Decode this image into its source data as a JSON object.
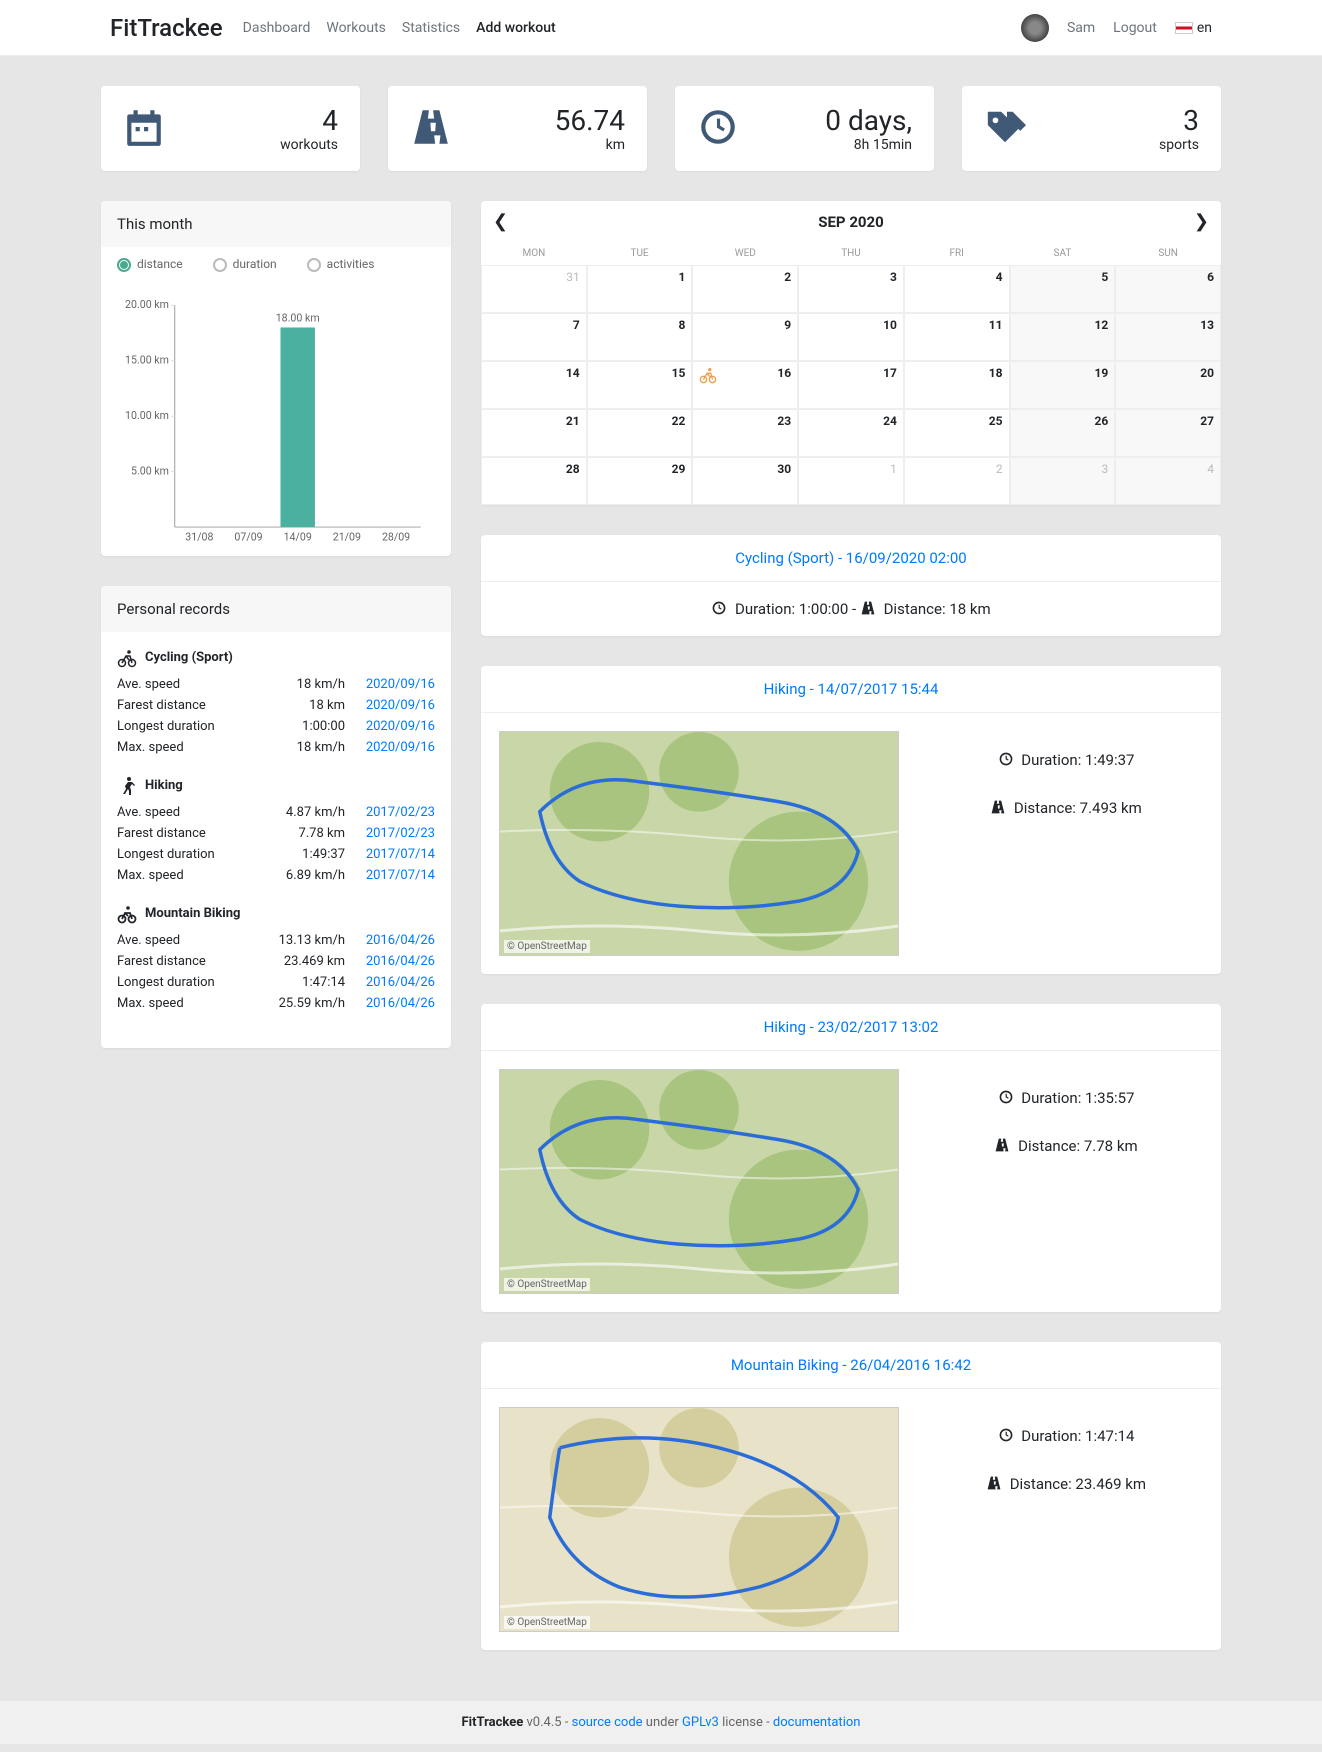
{
  "nav": {
    "brand": "FitTrackee",
    "links": [
      "Dashboard",
      "Workouts",
      "Statistics",
      "Add workout"
    ],
    "user": "Sam",
    "logout": "Logout",
    "lang": "en"
  },
  "stats": {
    "workouts": {
      "value": "4",
      "label": "workouts"
    },
    "distance": {
      "value": "56.74",
      "label": "km"
    },
    "duration": {
      "value": "0 days,",
      "label": "8h 15min"
    },
    "sports": {
      "value": "3",
      "label": "sports"
    }
  },
  "monthPanel": {
    "title": "This month",
    "radios": [
      "distance",
      "duration",
      "activities"
    ],
    "chart_data": {
      "type": "bar",
      "categories": [
        "31/08",
        "07/09",
        "14/09",
        "21/09",
        "28/09"
      ],
      "values": [
        0,
        0,
        18.0,
        0,
        0
      ],
      "value_labels": [
        "",
        "",
        "18.00 km",
        "",
        ""
      ],
      "ylabel": "km",
      "yticks": [
        5.0,
        10.0,
        15.0,
        20.0
      ],
      "ylim": [
        0,
        20
      ]
    }
  },
  "records": {
    "title": "Personal records",
    "labels": {
      "ave": "Ave. speed",
      "far": "Farest distance",
      "dur": "Longest duration",
      "max": "Max. speed"
    },
    "sports": [
      {
        "name": "Cycling (Sport)",
        "icon": "cycling",
        "rows": [
          {
            "label": "Ave. speed",
            "value": "18 km/h",
            "date": "2020/09/16"
          },
          {
            "label": "Farest distance",
            "value": "18 km",
            "date": "2020/09/16"
          },
          {
            "label": "Longest duration",
            "value": "1:00:00",
            "date": "2020/09/16"
          },
          {
            "label": "Max. speed",
            "value": "18 km/h",
            "date": "2020/09/16"
          }
        ]
      },
      {
        "name": "Hiking",
        "icon": "hiking",
        "rows": [
          {
            "label": "Ave. speed",
            "value": "4.87 km/h",
            "date": "2017/02/23"
          },
          {
            "label": "Farest distance",
            "value": "7.78 km",
            "date": "2017/02/23"
          },
          {
            "label": "Longest duration",
            "value": "1:49:37",
            "date": "2017/07/14"
          },
          {
            "label": "Max. speed",
            "value": "6.89 km/h",
            "date": "2017/07/14"
          }
        ]
      },
      {
        "name": "Mountain Biking",
        "icon": "mtb",
        "rows": [
          {
            "label": "Ave. speed",
            "value": "13.13 km/h",
            "date": "2016/04/26"
          },
          {
            "label": "Farest distance",
            "value": "23.469 km",
            "date": "2016/04/26"
          },
          {
            "label": "Longest duration",
            "value": "1:47:14",
            "date": "2016/04/26"
          },
          {
            "label": "Max. speed",
            "value": "25.59 km/h",
            "date": "2016/04/26"
          }
        ]
      }
    ]
  },
  "calendar": {
    "title": "SEP 2020",
    "dow": [
      "MON",
      "TUE",
      "WED",
      "THU",
      "FRI",
      "SAT",
      "SUN"
    ],
    "cells": [
      {
        "d": "31",
        "other": true
      },
      {
        "d": "1"
      },
      {
        "d": "2"
      },
      {
        "d": "3"
      },
      {
        "d": "4"
      },
      {
        "d": "5",
        "weekend": true
      },
      {
        "d": "6",
        "weekend": true
      },
      {
        "d": "7"
      },
      {
        "d": "8"
      },
      {
        "d": "9"
      },
      {
        "d": "10"
      },
      {
        "d": "11"
      },
      {
        "d": "12",
        "weekend": true
      },
      {
        "d": "13",
        "weekend": true
      },
      {
        "d": "14"
      },
      {
        "d": "15"
      },
      {
        "d": "16",
        "event": "cycling"
      },
      {
        "d": "17"
      },
      {
        "d": "18"
      },
      {
        "d": "19",
        "weekend": true
      },
      {
        "d": "20",
        "weekend": true
      },
      {
        "d": "21"
      },
      {
        "d": "22"
      },
      {
        "d": "23"
      },
      {
        "d": "24"
      },
      {
        "d": "25"
      },
      {
        "d": "26",
        "weekend": true
      },
      {
        "d": "27",
        "weekend": true
      },
      {
        "d": "28"
      },
      {
        "d": "29"
      },
      {
        "d": "30"
      },
      {
        "d": "1",
        "other": true
      },
      {
        "d": "2",
        "other": true
      },
      {
        "d": "3",
        "other": true,
        "weekend": true
      },
      {
        "d": "4",
        "other": true,
        "weekend": true
      }
    ]
  },
  "workouts": [
    {
      "title": "Cycling (Sport) - 16/09/2020 02:00",
      "map": false,
      "duration_label": "Duration:",
      "duration": "1:00:00",
      "distance_label": "Distance:",
      "distance": "18 km"
    },
    {
      "title": "Hiking - 14/07/2017 15:44",
      "map": true,
      "map_style": "forest",
      "duration_label": "Duration:",
      "duration": "1:49:37",
      "distance_label": "Distance:",
      "distance": "7.493 km"
    },
    {
      "title": "Hiking - 23/02/2017 13:02",
      "map": true,
      "map_style": "forest",
      "duration_label": "Duration:",
      "duration": "1:35:57",
      "distance_label": "Distance:",
      "distance": "7.78 km"
    },
    {
      "title": "Mountain Biking - 26/04/2016 16:42",
      "map": true,
      "map_style": "plains",
      "duration_label": "Duration:",
      "duration": "1:47:14",
      "distance_label": "Distance:",
      "distance": "23.469 km"
    }
  ],
  "map_attribution": "© OpenStreetMap",
  "footer": {
    "app": "FitTrackee",
    "version": " v0.4.5 - ",
    "source": "source code",
    "under": " under ",
    "gpl": "GPLv3",
    "license": " license - ",
    "docs": "documentation"
  }
}
